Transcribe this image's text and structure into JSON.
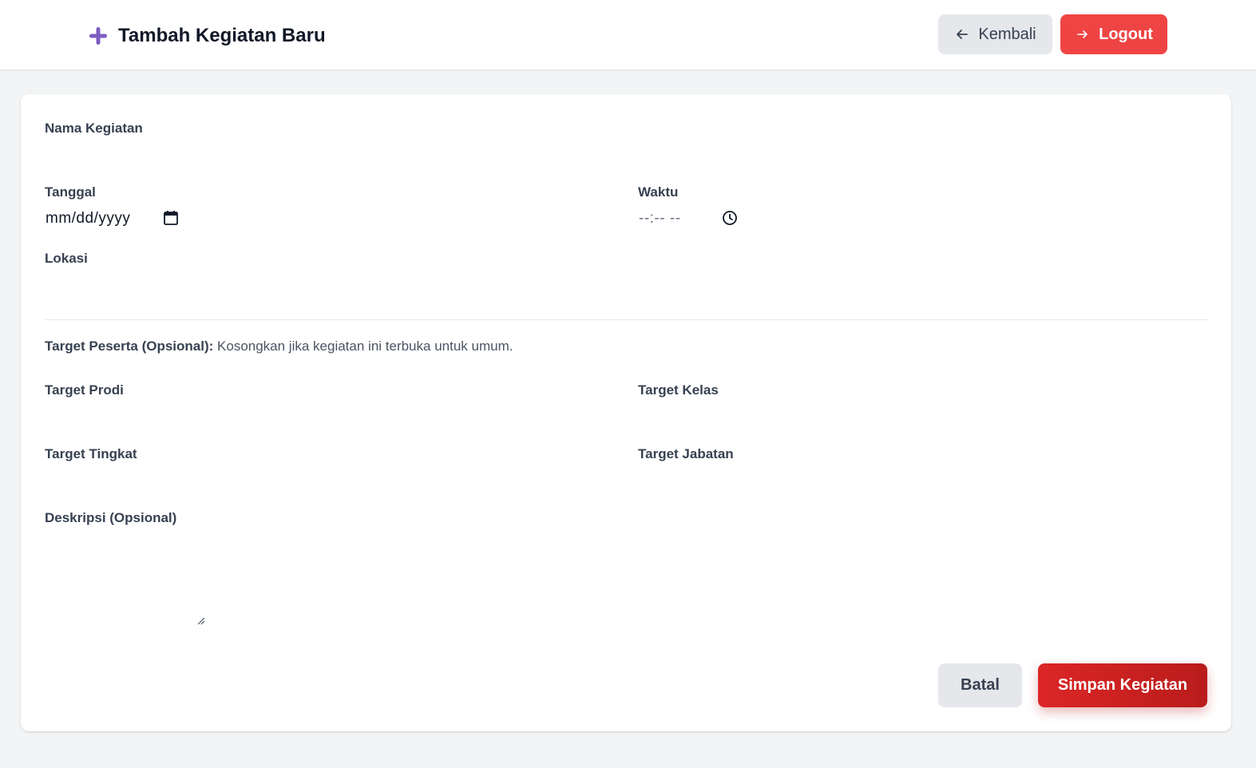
{
  "header": {
    "title": "Tambah Kegiatan Baru",
    "back_label": "Kembali",
    "logout_label": "Logout",
    "accent_color": "#7c5cbf",
    "logout_color": "#ef4444"
  },
  "form": {
    "nama_kegiatan_label": "Nama Kegiatan",
    "tanggal_label": "Tanggal",
    "tanggal_value": "mm/dd/yyyy",
    "waktu_label": "Waktu",
    "waktu_value": "--:-- --",
    "lokasi_label": "Lokasi",
    "target_note_bold": "Target Peserta (Opsional):",
    "target_note_text": " Kosongkan jika kegiatan ini terbuka untuk umum.",
    "target_prodi_label": "Target Prodi",
    "target_kelas_label": "Target Kelas",
    "target_tingkat_label": "Target Tingkat",
    "target_jabatan_label": "Target Jabatan",
    "deskripsi_label": "Deskripsi (Opsional)"
  },
  "actions": {
    "cancel_label": "Batal",
    "save_label": "Simpan Kegiatan",
    "save_color": "#dc2626"
  }
}
